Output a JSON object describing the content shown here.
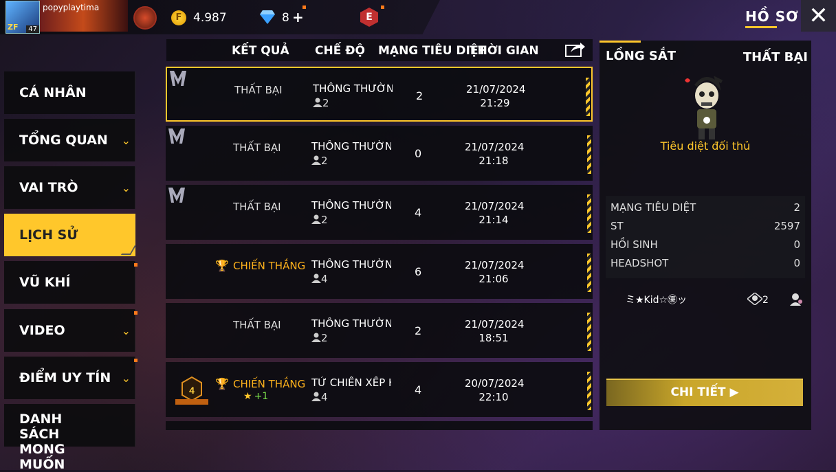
{
  "header": {
    "username": "popyplaytima",
    "level": "47",
    "gold": "4.987",
    "diamonds": "8",
    "diamonds_plus": "+",
    "ebadge": "E",
    "profile_tab": "HỒ SƠ",
    "close_icon": "close-icon"
  },
  "sidebar": {
    "items": [
      {
        "label": "CÁ NHÂN"
      },
      {
        "label": "TỔNG QUAN"
      },
      {
        "label": "VAI TRÒ"
      },
      {
        "label": "LỊCH SỬ"
      },
      {
        "label": "VŨ KHÍ"
      },
      {
        "label": "VIDEO"
      },
      {
        "label": "ĐIỂM UY TÍN"
      },
      {
        "label": "DANH SÁCH MONG MUỐN"
      }
    ]
  },
  "table": {
    "columns": [
      "KẾT QUẢ",
      "CHẾ ĐỘ",
      "MẠNG TIÊU DIỆT",
      "THỜI GIAN"
    ],
    "rows": [
      {
        "result": "THẤT BẠI",
        "mode": "THÔNG THƯỜNG-I",
        "players": "2",
        "kills": "2",
        "date": "21/07/2024",
        "time": "21:29"
      },
      {
        "result": "THẤT BẠI",
        "mode": "THÔNG THƯỜNG-I",
        "players": "2",
        "kills": "0",
        "date": "21/07/2024",
        "time": "21:18"
      },
      {
        "result": "THẤT BẠI",
        "mode": "THÔNG THƯỜNG-I",
        "players": "2",
        "kills": "4",
        "date": "21/07/2024",
        "time": "21:14"
      },
      {
        "result": "CHIẾN THẮNG",
        "mode": "THÔNG THƯỜNG-T",
        "players": "4",
        "kills": "6",
        "date": "21/07/2024",
        "time": "21:06"
      },
      {
        "result": "THẤT BẠI",
        "mode": "THÔNG THƯỜNG-I",
        "players": "2",
        "kills": "2",
        "date": "21/07/2024",
        "time": "18:51"
      },
      {
        "result": "CHIẾN THẮNG",
        "mode": "TỬ CHIẾN XẾP HẠ",
        "players": "4",
        "kills": "4",
        "date": "20/07/2024",
        "time": "22:10",
        "star": "★",
        "star_value": "+1",
        "booyah_rank": "4"
      }
    ]
  },
  "detail": {
    "mode": "LỒNG SẮT",
    "result": "THẤT BẠI",
    "caption": "Tiêu diệt đối thủ",
    "stats": [
      {
        "label": "MẠNG TIÊU DIỆT",
        "value": "2"
      },
      {
        "label": "ST",
        "value": "2597"
      },
      {
        "label": "HỒI SINH",
        "value": "0"
      },
      {
        "label": "HEADSHOT",
        "value": "0"
      }
    ],
    "player_name": "ミ★Kid☆㊝ッ",
    "player_kills": "2",
    "button": "CHI TIẾT"
  },
  "colors": {
    "accent": "#ffc72b",
    "win": "#ffb21c",
    "bonus": "#7be04a"
  }
}
